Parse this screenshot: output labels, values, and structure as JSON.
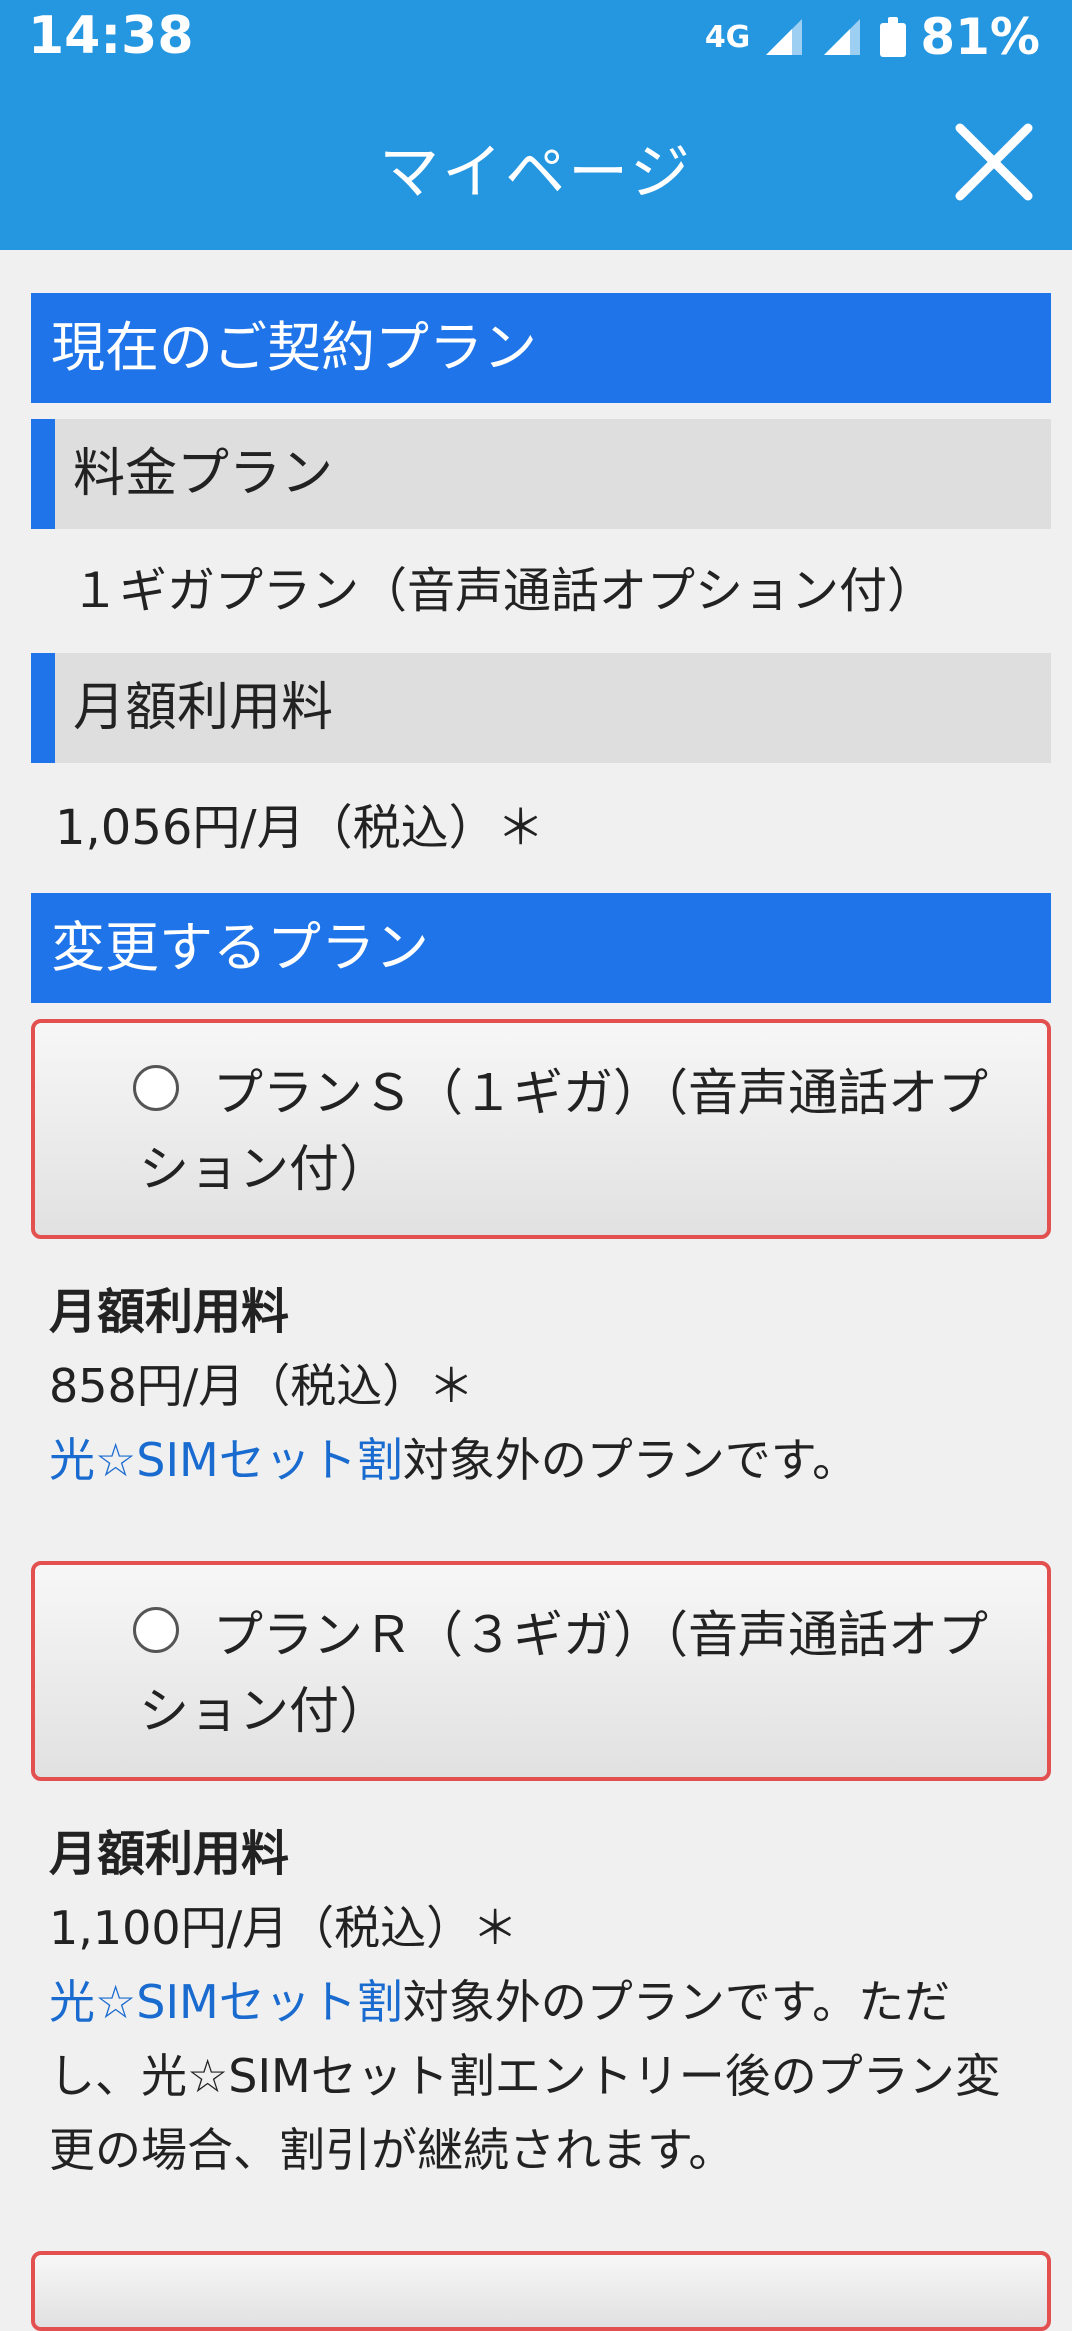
{
  "status_bar": {
    "time": "14:38",
    "network": "4G",
    "battery": "81%",
    "icons": [
      "signal-icon",
      "signal-icon",
      "battery-icon"
    ]
  },
  "app_bar": {
    "title": "マイページ",
    "close_icon": "close-icon"
  },
  "current_plan": {
    "header": "現在のご契約プラン",
    "plan_label": "料金プラン",
    "plan_value": "１ギガプラン（音声通話オプション付）",
    "fee_label": "月額利用料",
    "fee_value": "1,056円/月（税込）＊"
  },
  "change_plan": {
    "header": "変更するプラン",
    "options": [
      {
        "name": "プランＳ（１ギガ）（音声通話オプション付）",
        "fee_label": "月額利用料",
        "fee_value": "858円/月（税込）＊",
        "link_text": "光☆SIMセット割",
        "note": "対象外のプランです。"
      },
      {
        "name": "プランＲ（３ギガ）（音声通話オプション付）",
        "fee_label": "月額利用料",
        "fee_value": "1,100円/月（税込）＊",
        "link_text": "光☆SIMセット割",
        "note": "対象外のプランです。ただし、光☆SIMセット割エントリー後のプラン変更の場合、割引が継続されます。"
      }
    ]
  },
  "colors": {
    "app_bar": "#2596e0",
    "section_header": "#1e74e8",
    "option_border": "#e35050",
    "link": "#1a6bd0"
  }
}
